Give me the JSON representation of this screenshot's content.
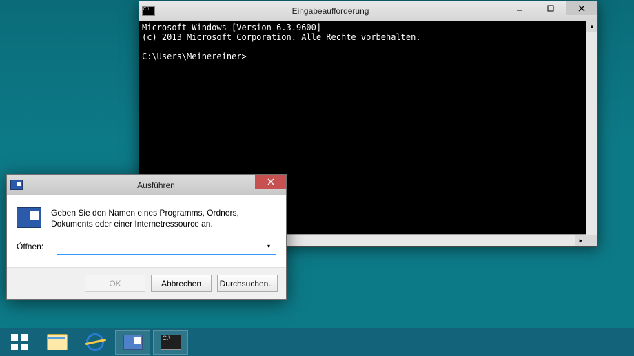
{
  "cmd": {
    "title": "Eingabeaufforderung",
    "icon_text": "C:\\.",
    "lines": {
      "l1": "Microsoft Windows [Version 6.3.9600]",
      "l2": "(c) 2013 Microsoft Corporation. Alle Rechte vorbehalten.",
      "l3": "",
      "l4": "C:\\Users\\Meinereiner>"
    }
  },
  "run": {
    "title": "Ausführen",
    "description": "Geben Sie den Namen eines Programms, Ordners, Dokuments oder einer Internetressource an.",
    "open_label": "Öffnen:",
    "input_value": "",
    "buttons": {
      "ok": "OK",
      "cancel": "Abbrechen",
      "browse": "Durchsuchen..."
    }
  },
  "taskbar": {
    "start": "Start",
    "explorer": "Explorer",
    "ie": "Internet Explorer",
    "run": "Ausführen",
    "cmd": "Eingabeaufforderung"
  }
}
